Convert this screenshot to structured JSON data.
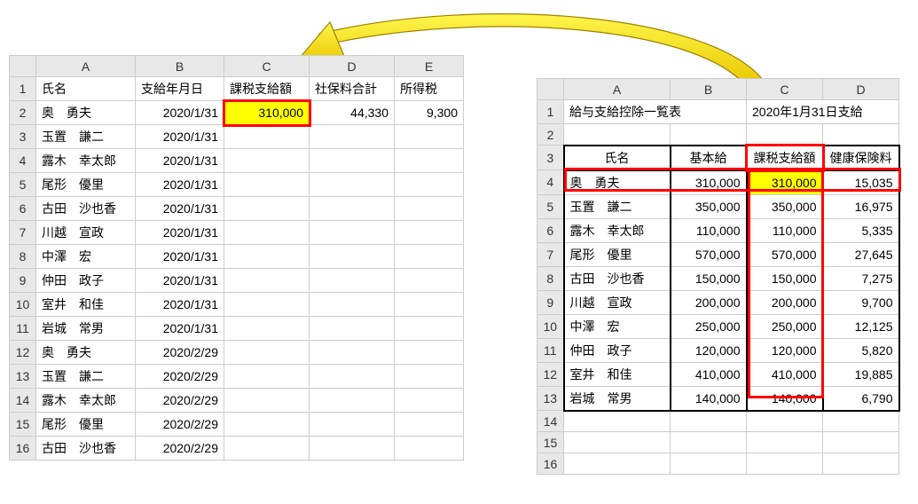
{
  "left": {
    "colHeaders": [
      "A",
      "B",
      "C",
      "D",
      "E"
    ],
    "headerRow": [
      "氏名",
      "支給年月日",
      "課税支給額",
      "社保料合計",
      "所得税"
    ],
    "rows": [
      {
        "name": "奥　勇夫",
        "date": "2020/1/31",
        "tax": "310,000",
        "soc": "44,330",
        "inc": "9,300"
      },
      {
        "name": "玉置　謙二",
        "date": "2020/1/31",
        "tax": "",
        "soc": "",
        "inc": ""
      },
      {
        "name": "露木　幸太郎",
        "date": "2020/1/31",
        "tax": "",
        "soc": "",
        "inc": ""
      },
      {
        "name": "尾形　優里",
        "date": "2020/1/31",
        "tax": "",
        "soc": "",
        "inc": ""
      },
      {
        "name": "古田　沙也香",
        "date": "2020/1/31",
        "tax": "",
        "soc": "",
        "inc": ""
      },
      {
        "name": "川越　宣政",
        "date": "2020/1/31",
        "tax": "",
        "soc": "",
        "inc": ""
      },
      {
        "name": "中澤　宏",
        "date": "2020/1/31",
        "tax": "",
        "soc": "",
        "inc": ""
      },
      {
        "name": "仲田　政子",
        "date": "2020/1/31",
        "tax": "",
        "soc": "",
        "inc": ""
      },
      {
        "name": "室井　和佳",
        "date": "2020/1/31",
        "tax": "",
        "soc": "",
        "inc": ""
      },
      {
        "name": "岩城　常男",
        "date": "2020/1/31",
        "tax": "",
        "soc": "",
        "inc": ""
      },
      {
        "name": "奥　勇夫",
        "date": "2020/2/29",
        "tax": "",
        "soc": "",
        "inc": ""
      },
      {
        "name": "玉置　謙二",
        "date": "2020/2/29",
        "tax": "",
        "soc": "",
        "inc": ""
      },
      {
        "name": "露木　幸太郎",
        "date": "2020/2/29",
        "tax": "",
        "soc": "",
        "inc": ""
      },
      {
        "name": "尾形　優里",
        "date": "2020/2/29",
        "tax": "",
        "soc": "",
        "inc": ""
      },
      {
        "name": "古田　沙也香",
        "date": "2020/2/29",
        "tax": "",
        "soc": "",
        "inc": ""
      }
    ]
  },
  "right": {
    "colHeaders": [
      "A",
      "B",
      "C",
      "D"
    ],
    "title": "給与支給控除一覧表",
    "titleDate": "2020年1月31日支給",
    "headerRow": [
      "氏名",
      "基本給",
      "課税支給額",
      "健康保険料"
    ],
    "rows": [
      {
        "name": "奥　勇夫",
        "base": "310,000",
        "tax": "310,000",
        "ins": "15,035"
      },
      {
        "name": "玉置　謙二",
        "base": "350,000",
        "tax": "350,000",
        "ins": "16,975"
      },
      {
        "name": "露木　幸太郎",
        "base": "110,000",
        "tax": "110,000",
        "ins": "5,335"
      },
      {
        "name": "尾形　優里",
        "base": "570,000",
        "tax": "570,000",
        "ins": "27,645"
      },
      {
        "name": "古田　沙也香",
        "base": "150,000",
        "tax": "150,000",
        "ins": "7,275"
      },
      {
        "name": "川越　宣政",
        "base": "200,000",
        "tax": "200,000",
        "ins": "9,700"
      },
      {
        "name": "中澤　宏",
        "base": "250,000",
        "tax": "250,000",
        "ins": "12,125"
      },
      {
        "name": "仲田　政子",
        "base": "120,000",
        "tax": "120,000",
        "ins": "5,820"
      },
      {
        "name": "室井　和佳",
        "base": "410,000",
        "tax": "410,000",
        "ins": "19,885"
      },
      {
        "name": "岩城　常男",
        "base": "140,000",
        "tax": "140,000",
        "ins": "6,790"
      }
    ]
  }
}
